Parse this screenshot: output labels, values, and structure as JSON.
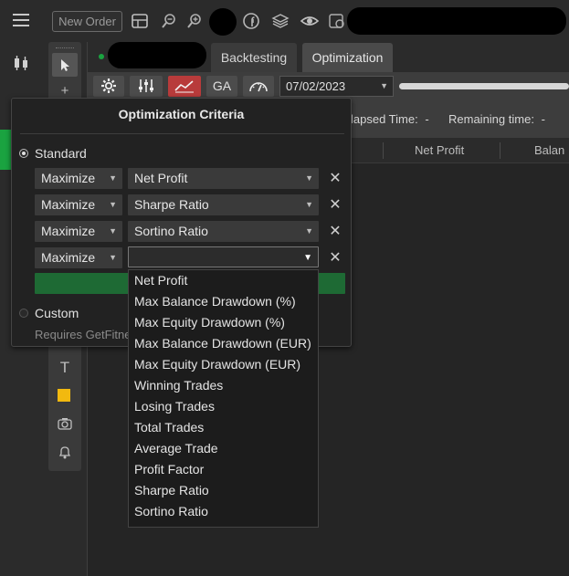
{
  "toolbar": {
    "new_order_label": "New Order",
    "icons": [
      "menu-icon",
      "layout-icon",
      "zoom-out-icon",
      "zoom-in-icon",
      "facebook-icon",
      "layers-icon",
      "eye-icon",
      "settings-icon"
    ]
  },
  "tabs": [
    "Backtesting",
    "Optimization"
  ],
  "optimization_toolbar": {
    "ga_label": "GA",
    "date": "07/02/2023"
  },
  "status": {
    "elapsed_label": "lapsed Time:",
    "elapsed_value": "-",
    "remaining_label": "Remaining time:",
    "remaining_value": "-"
  },
  "results_columns": [
    "Net Profit",
    "Balan"
  ],
  "criteria_panel": {
    "title": "Optimization Criteria",
    "standard_label": "Standard",
    "custom_label": "Custom",
    "custom_note": "Requires GetFitne",
    "rows": [
      {
        "direction": "Maximize",
        "metric": "Net Profit"
      },
      {
        "direction": "Maximize",
        "metric": "Sharpe Ratio"
      },
      {
        "direction": "Maximize",
        "metric": "Sortino Ratio"
      },
      {
        "direction": "Maximize",
        "metric": ""
      }
    ],
    "remove_glyph": "✕"
  },
  "dropdown_options": [
    "Net Profit",
    "Max Balance Drawdown (%)",
    "Max Equity Drawdown (%)",
    "Max Balance Drawdown (EUR)",
    "Max Equity Drawdown (EUR)",
    "Winning Trades",
    "Losing Trades",
    "Total Trades",
    "Average Trade",
    "Profit Factor",
    "Sharpe Ratio",
    "Sortino Ratio"
  ],
  "drawing_tools": {
    "text_tool_glyph": "T"
  },
  "colors": {
    "accent_green": "#1aa340",
    "run_button": "#1e6a34",
    "highlight_red": "#b83b3b"
  }
}
